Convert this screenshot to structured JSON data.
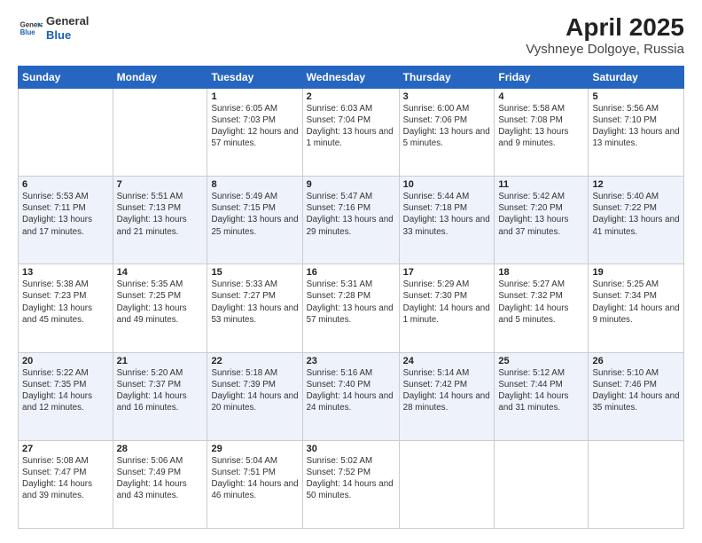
{
  "header": {
    "logo_line1": "General",
    "logo_line2": "Blue",
    "title": "April 2025",
    "subtitle": "Vyshneye Dolgoye, Russia"
  },
  "weekdays": [
    "Sunday",
    "Monday",
    "Tuesday",
    "Wednesday",
    "Thursday",
    "Friday",
    "Saturday"
  ],
  "weeks": [
    [
      {
        "day": "",
        "info": ""
      },
      {
        "day": "",
        "info": ""
      },
      {
        "day": "1",
        "info": "Sunrise: 6:05 AM\nSunset: 7:03 PM\nDaylight: 12 hours and 57 minutes."
      },
      {
        "day": "2",
        "info": "Sunrise: 6:03 AM\nSunset: 7:04 PM\nDaylight: 13 hours and 1 minute."
      },
      {
        "day": "3",
        "info": "Sunrise: 6:00 AM\nSunset: 7:06 PM\nDaylight: 13 hours and 5 minutes."
      },
      {
        "day": "4",
        "info": "Sunrise: 5:58 AM\nSunset: 7:08 PM\nDaylight: 13 hours and 9 minutes."
      },
      {
        "day": "5",
        "info": "Sunrise: 5:56 AM\nSunset: 7:10 PM\nDaylight: 13 hours and 13 minutes."
      }
    ],
    [
      {
        "day": "6",
        "info": "Sunrise: 5:53 AM\nSunset: 7:11 PM\nDaylight: 13 hours and 17 minutes."
      },
      {
        "day": "7",
        "info": "Sunrise: 5:51 AM\nSunset: 7:13 PM\nDaylight: 13 hours and 21 minutes."
      },
      {
        "day": "8",
        "info": "Sunrise: 5:49 AM\nSunset: 7:15 PM\nDaylight: 13 hours and 25 minutes."
      },
      {
        "day": "9",
        "info": "Sunrise: 5:47 AM\nSunset: 7:16 PM\nDaylight: 13 hours and 29 minutes."
      },
      {
        "day": "10",
        "info": "Sunrise: 5:44 AM\nSunset: 7:18 PM\nDaylight: 13 hours and 33 minutes."
      },
      {
        "day": "11",
        "info": "Sunrise: 5:42 AM\nSunset: 7:20 PM\nDaylight: 13 hours and 37 minutes."
      },
      {
        "day": "12",
        "info": "Sunrise: 5:40 AM\nSunset: 7:22 PM\nDaylight: 13 hours and 41 minutes."
      }
    ],
    [
      {
        "day": "13",
        "info": "Sunrise: 5:38 AM\nSunset: 7:23 PM\nDaylight: 13 hours and 45 minutes."
      },
      {
        "day": "14",
        "info": "Sunrise: 5:35 AM\nSunset: 7:25 PM\nDaylight: 13 hours and 49 minutes."
      },
      {
        "day": "15",
        "info": "Sunrise: 5:33 AM\nSunset: 7:27 PM\nDaylight: 13 hours and 53 minutes."
      },
      {
        "day": "16",
        "info": "Sunrise: 5:31 AM\nSunset: 7:28 PM\nDaylight: 13 hours and 57 minutes."
      },
      {
        "day": "17",
        "info": "Sunrise: 5:29 AM\nSunset: 7:30 PM\nDaylight: 14 hours and 1 minute."
      },
      {
        "day": "18",
        "info": "Sunrise: 5:27 AM\nSunset: 7:32 PM\nDaylight: 14 hours and 5 minutes."
      },
      {
        "day": "19",
        "info": "Sunrise: 5:25 AM\nSunset: 7:34 PM\nDaylight: 14 hours and 9 minutes."
      }
    ],
    [
      {
        "day": "20",
        "info": "Sunrise: 5:22 AM\nSunset: 7:35 PM\nDaylight: 14 hours and 12 minutes."
      },
      {
        "day": "21",
        "info": "Sunrise: 5:20 AM\nSunset: 7:37 PM\nDaylight: 14 hours and 16 minutes."
      },
      {
        "day": "22",
        "info": "Sunrise: 5:18 AM\nSunset: 7:39 PM\nDaylight: 14 hours and 20 minutes."
      },
      {
        "day": "23",
        "info": "Sunrise: 5:16 AM\nSunset: 7:40 PM\nDaylight: 14 hours and 24 minutes."
      },
      {
        "day": "24",
        "info": "Sunrise: 5:14 AM\nSunset: 7:42 PM\nDaylight: 14 hours and 28 minutes."
      },
      {
        "day": "25",
        "info": "Sunrise: 5:12 AM\nSunset: 7:44 PM\nDaylight: 14 hours and 31 minutes."
      },
      {
        "day": "26",
        "info": "Sunrise: 5:10 AM\nSunset: 7:46 PM\nDaylight: 14 hours and 35 minutes."
      }
    ],
    [
      {
        "day": "27",
        "info": "Sunrise: 5:08 AM\nSunset: 7:47 PM\nDaylight: 14 hours and 39 minutes."
      },
      {
        "day": "28",
        "info": "Sunrise: 5:06 AM\nSunset: 7:49 PM\nDaylight: 14 hours and 43 minutes."
      },
      {
        "day": "29",
        "info": "Sunrise: 5:04 AM\nSunset: 7:51 PM\nDaylight: 14 hours and 46 minutes."
      },
      {
        "day": "30",
        "info": "Sunrise: 5:02 AM\nSunset: 7:52 PM\nDaylight: 14 hours and 50 minutes."
      },
      {
        "day": "",
        "info": ""
      },
      {
        "day": "",
        "info": ""
      },
      {
        "day": "",
        "info": ""
      }
    ]
  ]
}
